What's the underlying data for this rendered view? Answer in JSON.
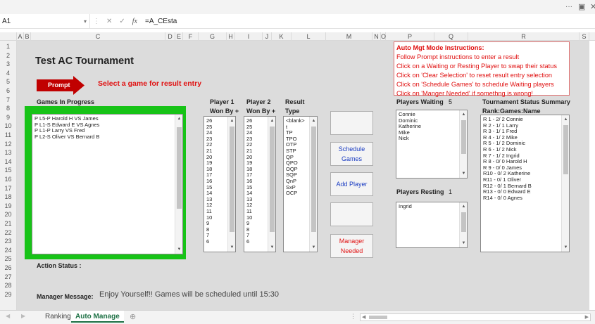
{
  "window": {
    "more": "···",
    "restore": "▣"
  },
  "formula_bar": {
    "cell": "A1",
    "formula": "=A_CEsta"
  },
  "columns": [
    "A",
    "B",
    "C",
    "D",
    "E",
    "F",
    "G",
    "H",
    "I",
    "J",
    "K",
    "L",
    "M",
    "N",
    "O",
    "P",
    "Q",
    "R",
    "S"
  ],
  "rows": [
    "1",
    "2",
    "3",
    "4",
    "5",
    "6",
    "7",
    "8",
    "9",
    "10",
    "11",
    "12",
    "13",
    "14",
    "15",
    "16",
    "17",
    "18",
    "19",
    "20",
    "21",
    "22",
    "23",
    "24",
    "25",
    "26",
    "27",
    "28",
    "29"
  ],
  "title": "Test AC Tournament",
  "prompt": {
    "badge": "Prompt",
    "message": "Select a game for result entry"
  },
  "instructions": [
    "Auto Mgt Mode Instructions:",
    "Follow Prompt instructions to enter a result",
    "Click on  a Waiting or Resting Player to swap their status",
    "Click on 'Clear Selection' to reset result entry selection",
    "Click on 'Schedule Games' to schedule Waiting players",
    "Click on 'Manger Needed' if somethng is wrong!"
  ],
  "games": {
    "label": "Games In Progress",
    "items": [
      "P  L5-P  Harold H  VS  James",
      "P  L1-S  Edward E  VS  Agnes",
      "P  L1-P  Larry  VS  Fred",
      "P  L2-S  Oliver  VS  Bernard B"
    ]
  },
  "player1": {
    "label1": "Player 1",
    "label2": "Won By +",
    "items": [
      "26",
      "25",
      "24",
      "23",
      "22",
      "21",
      "20",
      "19",
      "18",
      "17",
      "16",
      "15",
      "14",
      "13",
      "12",
      "11",
      "10",
      "9",
      "8",
      "7",
      "6"
    ]
  },
  "player2": {
    "label1": "Player 2",
    "label2": "Won By +",
    "items": [
      "26",
      "25",
      "24",
      "23",
      "22",
      "21",
      "20",
      "19",
      "18",
      "17",
      "16",
      "15",
      "14",
      "13",
      "12",
      "11",
      "10",
      "9",
      "8",
      "7",
      "6"
    ]
  },
  "result": {
    "label1": "Result",
    "label2": "Type",
    "items": [
      "<blank>",
      "t",
      "TP",
      "TPO",
      "OTP",
      "STP",
      "QP",
      "QPO",
      "OQP",
      "SQP",
      "QnP",
      "SxP",
      "OCP"
    ]
  },
  "buttons": {
    "blank1": "",
    "schedule": "Schedule Games",
    "add": "Add Player",
    "blank2": "",
    "manager": "Manager Needed"
  },
  "waiting": {
    "label": "Players Waiting",
    "count": "5",
    "items": [
      "Connie",
      "Dominic",
      "Katherine",
      "Mike",
      "Nick"
    ]
  },
  "resting": {
    "label": "Players Resting",
    "count": "1",
    "items": [
      "Ingrid"
    ]
  },
  "summary": {
    "label1": "Tournament Status Summary",
    "label2": "Rank:Games:Name",
    "items": [
      "R  1 -  2/ 2  Connie",
      "R  2 -  1/ 1  Larry",
      "R  3 -  1/ 1  Fred",
      "R  4 -  1/ 2  Mike",
      "R  5 -  1/ 2  Dominic",
      "R  6 -  1/ 2  Nick",
      "R  7 -  1/ 2  Ingrid",
      "R  8 -  0/ 0  Harold H",
      "R  9 -  0/ 0  James",
      "R10 -  0/ 2  Katherine",
      "R11 -  0/ 1  Oliver",
      "R12 -  0/ 1  Bernard B",
      "R13 -  0/ 0  Edward E",
      "R14 -  0/ 0  Agnes"
    ]
  },
  "action_status": "Action Status :",
  "manager_message": {
    "label": "Manager Message:",
    "text": "Enjoy Yourself!! Games will be scheduled until 15:30"
  },
  "sheets": [
    "Ranking",
    "Auto Manage"
  ],
  "add_sheet": "⊕"
}
